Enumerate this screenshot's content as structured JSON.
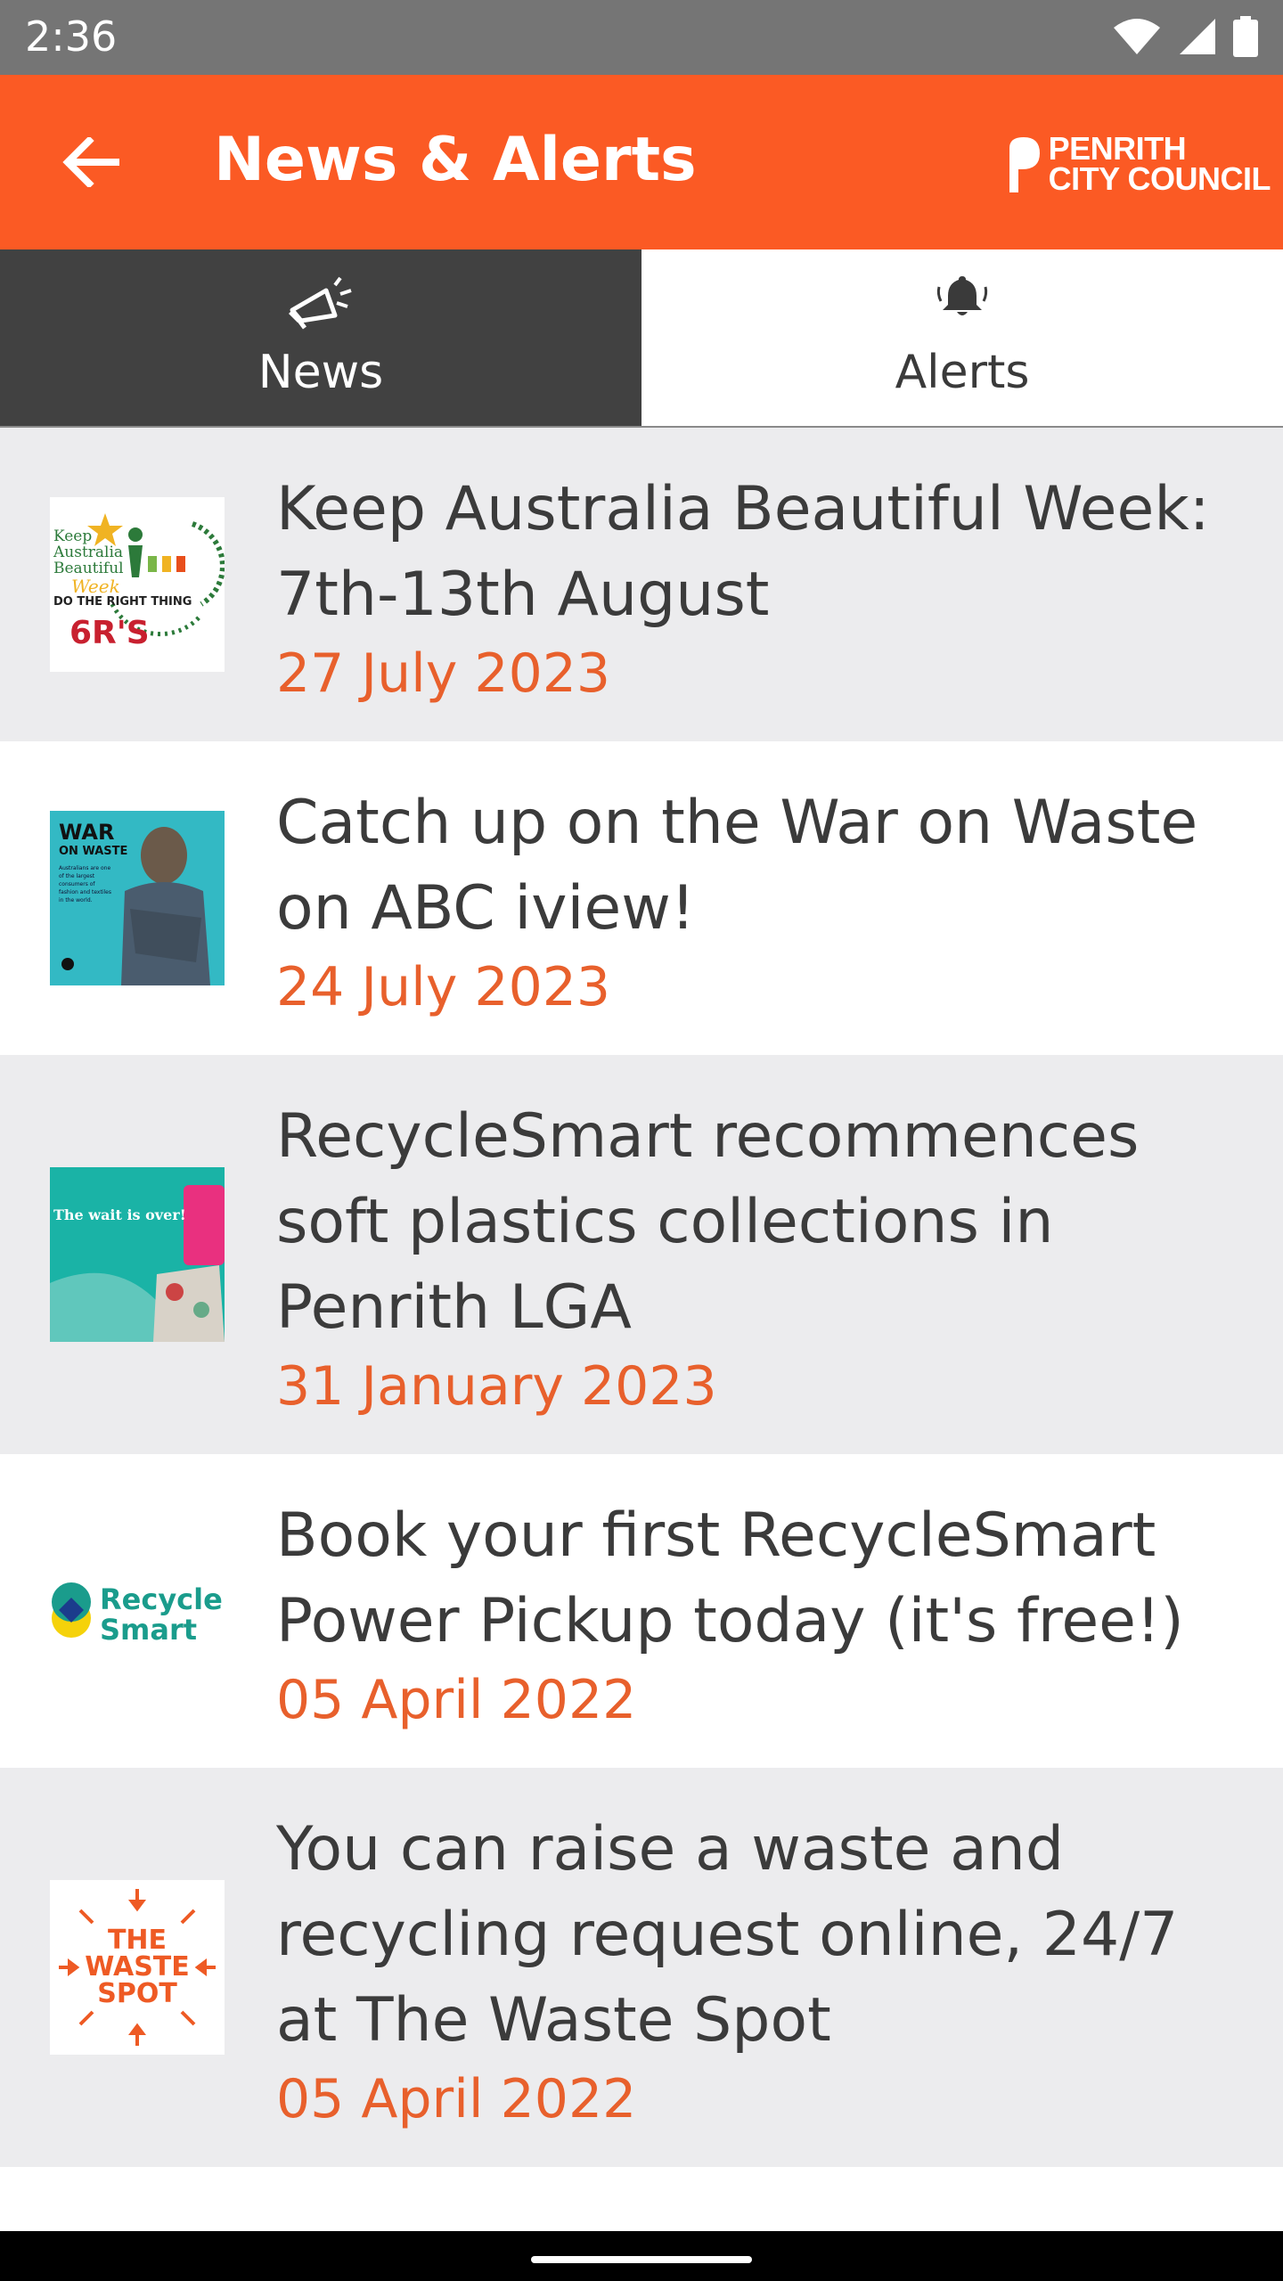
{
  "status_bar": {
    "time": "2:36"
  },
  "app_bar": {
    "title": "News & Alerts",
    "logo_text": "PENRITH\nCITY COUNCIL",
    "background": "#fb5a24"
  },
  "tabs": [
    {
      "label": "News",
      "icon": "megaphone-icon",
      "active": true
    },
    {
      "label": "Alerts",
      "icon": "bell-icon",
      "active": false
    }
  ],
  "news": [
    {
      "title": "Keep Australia Beautiful Week: 7th-13th August",
      "date": "27 July 2023",
      "thumb": "keep-australia-beautiful-thumbnail",
      "thumb_text": [
        "Keep",
        "Australia",
        "Beautiful",
        "Week",
        "DO THE RIGHT THING",
        "6R'S"
      ]
    },
    {
      "title": "Catch up on the War on Waste on ABC iview!",
      "date": "24 July 2023",
      "thumb": "war-on-waste-thumbnail",
      "thumb_text": [
        "WAR",
        "ON WASTE",
        "Australians are one of the largest consumers of fashion and textiles in the world."
      ]
    },
    {
      "title": "RecycleSmart recommences soft plastics collections in Penrith LGA",
      "date": "31 January 2023",
      "thumb": "soft-plastics-thumbnail",
      "thumb_text": [
        "The wait is over!"
      ]
    },
    {
      "title": "Book your first RecycleSmart Power Pickup today (it's free!)",
      "date": "05 April 2022",
      "thumb": "recyclesmart-logo-thumbnail",
      "thumb_text": [
        "Recycle",
        "Smart"
      ]
    },
    {
      "title": "You can raise a waste and recycling request online, 24/7 at The Waste Spot",
      "date": "05 April 2022",
      "thumb": "waste-spot-thumbnail",
      "thumb_text": [
        "THE",
        "WASTE",
        "SPOT"
      ]
    }
  ],
  "colors": {
    "accent": "#fb5a24",
    "date": "#e8602c",
    "tab_active": "#414141",
    "row_shaded": "#ececee"
  }
}
